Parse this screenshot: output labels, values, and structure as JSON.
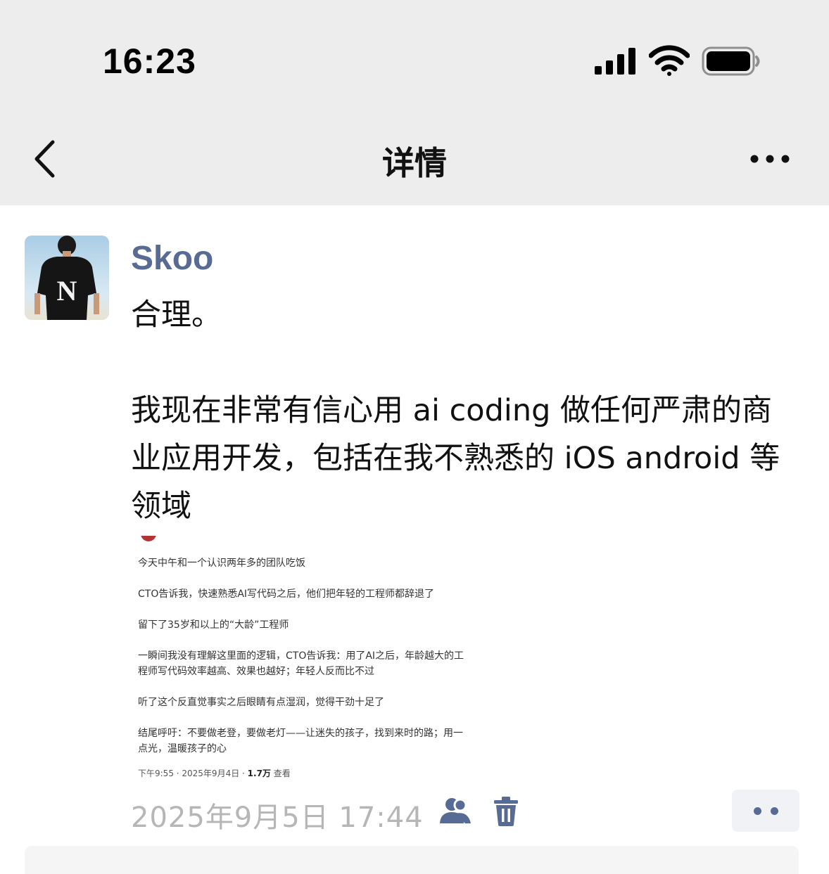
{
  "status_bar": {
    "time": "16:23",
    "icons": [
      "signal-icon",
      "wifi-icon",
      "battery-icon"
    ]
  },
  "nav": {
    "title": "详情",
    "back_icon": "chevron-left-icon",
    "more_icon": "more-horizontal-icon"
  },
  "post": {
    "author": "Skoo",
    "text_paragraphs": [
      "合理。",
      "我现在非常有信心用 ai coding 做任何严肃的商业应用开发，包括在我不熟悉的 iOS android 等领域"
    ],
    "image": {
      "lines": [
        "今天中午和一个认识两年多的团队吃饭",
        "CTO告诉我，快速熟悉AI写代码之后，他们把年轻的工程师都辞退了",
        "留下了35岁和以上的“大龄”工程师",
        "一瞬间我没有理解这里面的逻辑，CTO告诉我：用了AI之后，年龄越大的工",
        "程师写代码效率越高、效果也越好；年轻人反而比不过",
        "听了这个反直觉事实之后眼睛有点湿润，觉得干劲十足了",
        "结尾呼吁：不要做老登，要做老灯——让迷失的孩子，找到来时的路；用一",
        "点光，温暖孩子的心"
      ],
      "meta_prefix": "下午9:55 · 2025年9月4日 · ",
      "meta_views": "1.7万",
      "meta_suffix": " 查看"
    },
    "timestamp": "2025年9月5日 17:44",
    "friends_icon": "friends-visibility-icon",
    "delete_icon": "trash-icon",
    "action_icon": "more-dots-icon"
  },
  "colors": {
    "accent": "#576b95",
    "topbar_bg": "#ededed",
    "timestamp": "#b6b6b6"
  }
}
